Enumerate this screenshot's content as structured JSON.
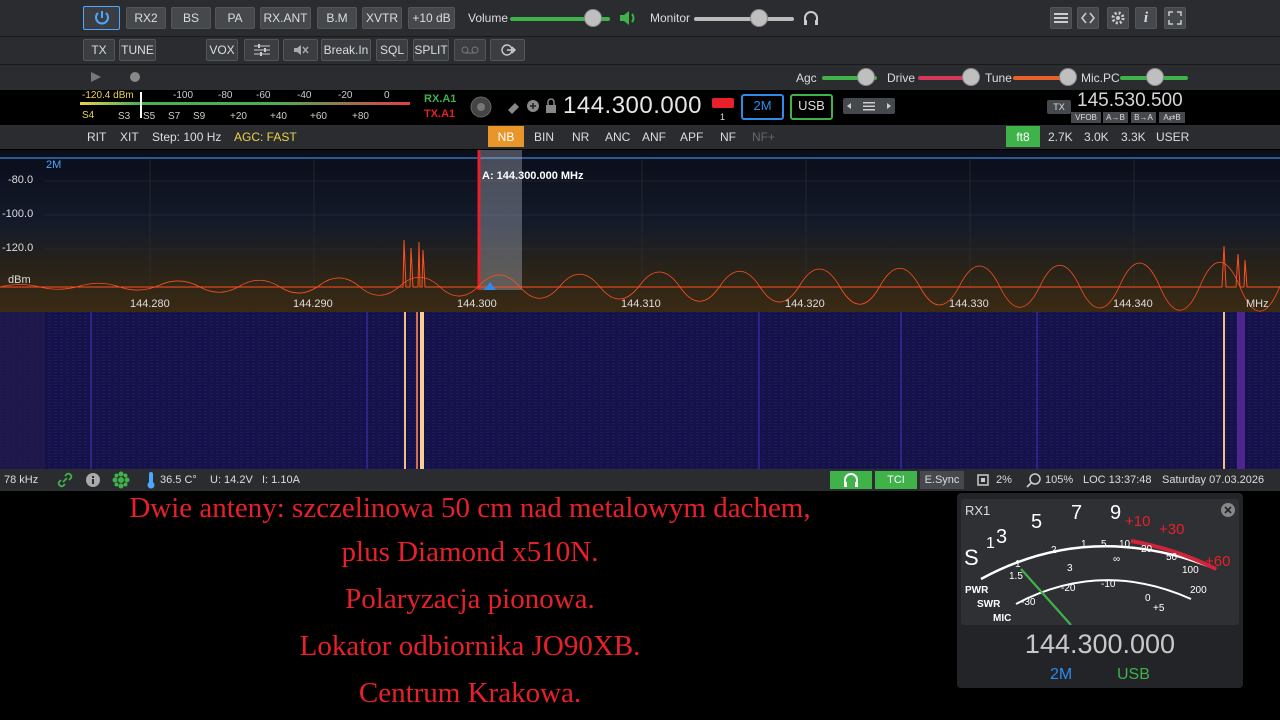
{
  "top_bar": {
    "buttons": [
      "RX2",
      "BS",
      "PA",
      "RX.ANT",
      "B.M",
      "XVTR",
      "+10 dB"
    ],
    "volume_label": "Volume",
    "volume_level": 0.85,
    "monitor_label": "Monitor",
    "monitor_level": 0.7
  },
  "second_bar": {
    "buttons": [
      "TX",
      "TUNE",
      "VOX",
      "Break.In",
      "SQL",
      "SPLIT"
    ]
  },
  "third_bar": {
    "agc_label": "Agc",
    "drive_label": "Drive",
    "tune_label": "Tune",
    "mic_label": "Mic.PC"
  },
  "smeter": {
    "dbm": "-120.4 dBm",
    "s_value": "S4",
    "top_scale": [
      "-100",
      "-80",
      "-60",
      "-40",
      "-20",
      "0"
    ],
    "bottom_scale": [
      "S3",
      "S5",
      "S7",
      "S9",
      "+20",
      "+40",
      "+60",
      "+80"
    ]
  },
  "vfo": {
    "rx_antenna": "RX.A1",
    "tx_antenna": "TX.A1",
    "frequency_a": "144.300.000",
    "channel_badge": "1",
    "band": "2M",
    "mode": "USB",
    "tx_badge": "TX",
    "frequency_b": "145.530.500",
    "vfo_buttons": [
      "VFOB",
      "A→B",
      "B→A",
      "A⇄B"
    ]
  },
  "dsp_bar": {
    "rit": "RIT",
    "xit": "XIT",
    "step": "Step: 100 Hz",
    "agc": "AGC: FAST",
    "filters": [
      "NB",
      "BIN",
      "NR",
      "ANC",
      "ANF",
      "APF",
      "NF",
      "NF+"
    ],
    "active_filter": "NB",
    "bandwidths": [
      "ft8",
      "2.7K",
      "3.0K",
      "3.3K",
      "USER"
    ],
    "active_bandwidth": "ft8"
  },
  "spectrum": {
    "band_label": "2M",
    "y_labels": [
      "-80.0",
      "-100.0",
      "-120.0",
      "dBm"
    ],
    "marker_label": "A: 144.300.000 MHz",
    "freq_labels": [
      "144.280",
      "144.290",
      "144.300",
      "144.310",
      "144.320",
      "144.330",
      "144.340"
    ],
    "freq_unit": "MHz"
  },
  "status_bar": {
    "span": "78 kHz",
    "temperature": "36.5 C°",
    "voltage": "U: 14.2V",
    "current": "I: 1.10A",
    "tci": "TCI",
    "esync": "E.Sync",
    "cpu": "2%",
    "zoom": "105%",
    "clock": "LOC 13:37:48",
    "date": "Saturday 07.03.2026"
  },
  "caption": {
    "lines": [
      "Dwie anteny: szczelinowa 50 cm nad metalowym dachem,",
      "plus Diamond x510N.",
      "Polaryzacja pionowa.",
      "Lokator odbiornika JO90XB.",
      "Centrum Krakowa."
    ]
  },
  "meter_panel": {
    "title": "RX1",
    "s_scale": [
      "S",
      "1",
      "3",
      "5",
      "7",
      "9",
      "+10",
      "+30",
      "+60"
    ],
    "pwr_scale": [
      "1",
      "5",
      "10",
      "20",
      "50",
      "100",
      "200"
    ],
    "swr_scale": [
      "1",
      "1.5",
      "2",
      "3",
      "∞"
    ],
    "mic_scale": [
      "-30",
      "-20",
      "-10",
      "0",
      "+5"
    ],
    "row_labels": [
      "PWR",
      "SWR",
      "MIC"
    ],
    "frequency": "144.300.000",
    "band": "2M",
    "mode": "USB"
  },
  "colors": {
    "accent_blue": "#2e8bea",
    "green": "#3fb24a",
    "red": "#e8202a",
    "spectrum_trace": "#ff5020"
  }
}
